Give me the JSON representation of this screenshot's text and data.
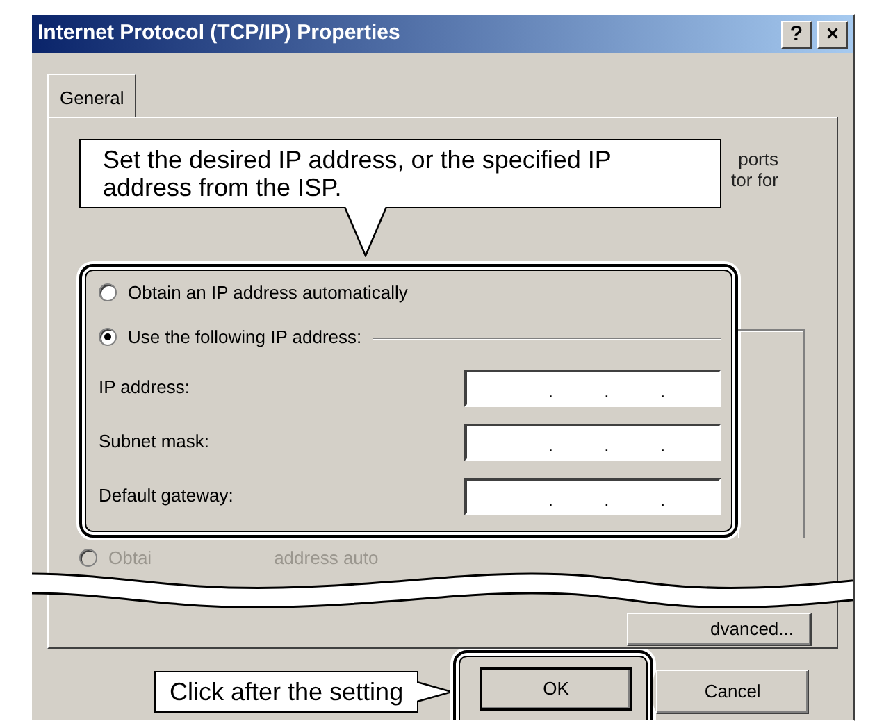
{
  "window": {
    "title": "Internet Protocol (TCP/IP) Properties",
    "title_buttons": [
      "?",
      "×"
    ]
  },
  "tabs": [
    {
      "label": "General",
      "selected": true
    }
  ],
  "intro_fragments": [
    "ports",
    "tor for"
  ],
  "radios": [
    {
      "label": "Obtain an IP address automatically",
      "selected": false
    },
    {
      "label": "Use the following IP address:",
      "selected": true
    }
  ],
  "fields": [
    {
      "label": "IP address:",
      "separators": [
        ".",
        ".",
        "."
      ]
    },
    {
      "label": "Subnet mask:",
      "separators": [
        ".",
        ".",
        "."
      ]
    },
    {
      "label": "Default gateway:",
      "separators": [
        ".",
        ".",
        "."
      ]
    }
  ],
  "hidden_radio": {
    "fragments": [
      "Obtai",
      "address auto"
    ],
    "disabled": true
  },
  "advanced_button": "dvanced...",
  "buttons": [
    {
      "label": "OK",
      "highlighted": true
    },
    {
      "label": "Cancel",
      "highlighted": false
    }
  ],
  "callouts": [
    {
      "text": "Set the desired IP address, or the specified IP address from the ISP."
    },
    {
      "text": "Click after the setting"
    }
  ]
}
